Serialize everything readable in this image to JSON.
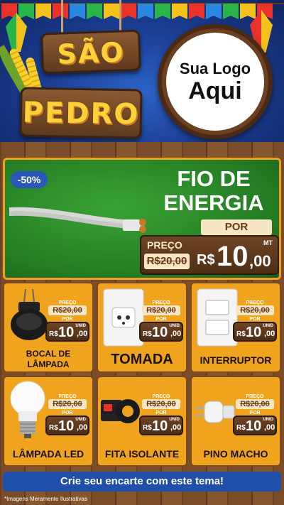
{
  "header": {
    "title_line1": "SÃO",
    "title_line2": "PEDRO",
    "logo_line1": "Sua Logo",
    "logo_line2": "Aqui"
  },
  "featured": {
    "discount": "-50%",
    "title_line1": "FIO DE",
    "title_line2": "ENERGIA",
    "por_label": "POR",
    "preco_label": "PREÇO",
    "old_price": "R$20,00",
    "currency": "R$",
    "new_price": "10",
    "new_cents": ",00",
    "unit": "MT"
  },
  "products": [
    {
      "name": "BOCAL DE LÂMPADA",
      "preco_label": "PREÇO",
      "old_price": "R$20,00",
      "por_label": "POR",
      "currency": "R$",
      "new_price": "10",
      "new_cents": ",00",
      "unit": "UNID"
    },
    {
      "name": "TOMADA",
      "preco_label": "PREÇO",
      "old_price": "R$20,00",
      "por_label": "POR",
      "currency": "R$",
      "new_price": "10",
      "new_cents": ",00",
      "unit": "UNID"
    },
    {
      "name": "INTERRUPTOR",
      "preco_label": "PREÇO",
      "old_price": "R$20,00",
      "por_label": "POR",
      "currency": "R$",
      "new_price": "10",
      "new_cents": ",00",
      "unit": "UNID"
    },
    {
      "name": "LÂMPADA LED",
      "preco_label": "PREÇO",
      "old_price": "R$20,00",
      "por_label": "POR",
      "currency": "R$",
      "new_price": "10",
      "new_cents": ",00",
      "unit": "UNID"
    },
    {
      "name": "FITA ISOLANTE",
      "preco_label": "PREÇO",
      "old_price": "R$20,00",
      "por_label": "POR",
      "currency": "R$",
      "new_price": "10",
      "new_cents": ",00",
      "unit": "UNID"
    },
    {
      "name": "PINO MACHO",
      "preco_label": "PREÇO",
      "old_price": "R$20,00",
      "por_label": "POR",
      "currency": "R$",
      "new_price": "10",
      "new_cents": ",00",
      "unit": "UNID"
    }
  ],
  "cta_label": "Crie seu encarte com este tema!",
  "disclaimer": "*Imagens Meramente Ilustrativas",
  "colors": {
    "header_blue": "#1c3f96",
    "card_orange": "#f0a31c",
    "hero_green": "#2e8c2a",
    "cta_blue": "#1f4fa8",
    "title_yellow": "#ffd23a"
  }
}
